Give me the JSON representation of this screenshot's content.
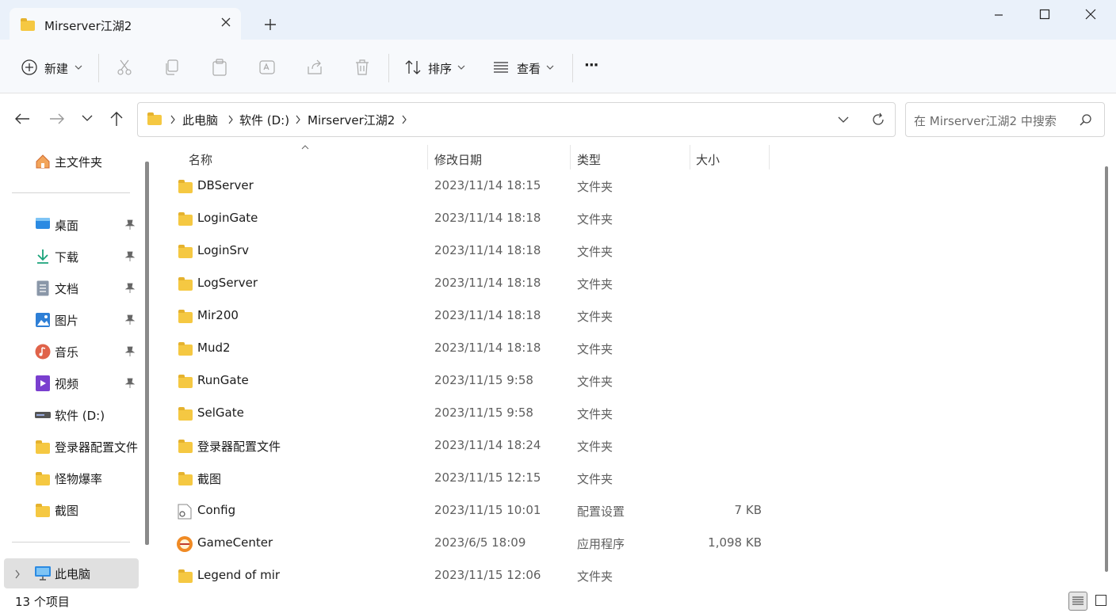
{
  "window": {
    "tab_title": "Mirserver江湖2",
    "minimize_icon": "minimize-icon",
    "maximize_icon": "maximize-icon",
    "close_icon": "close-icon"
  },
  "toolbar": {
    "new_label": "新建",
    "sort_label": "排序",
    "view_label": "查看",
    "more_label": "···"
  },
  "nav": {
    "breadcrumb": [
      "此电脑",
      "软件 (D:)",
      "Mirserver江湖2"
    ],
    "search_placeholder": "在 Mirserver江湖2 中搜索"
  },
  "sidebar": {
    "home": "主文件夹",
    "quick": [
      {
        "label": "桌面",
        "icon": "desktop-icon",
        "color": "#2b8ae2"
      },
      {
        "label": "下载",
        "icon": "download-icon",
        "color": "#1aa37a"
      },
      {
        "label": "文档",
        "icon": "document-icon",
        "color": "#6e7a8a"
      },
      {
        "label": "图片",
        "icon": "pictures-icon",
        "color": "#2e7fd6"
      },
      {
        "label": "音乐",
        "icon": "music-icon",
        "color": "#e0634a"
      },
      {
        "label": "视频",
        "icon": "video-icon",
        "color": "#7a3fcf"
      }
    ],
    "drives": [
      {
        "label": "软件 (D:)",
        "icon": "drive-icon"
      },
      {
        "label": "登录器配置文件",
        "icon": "folder-icon"
      },
      {
        "label": "怪物爆率",
        "icon": "folder-icon"
      },
      {
        "label": "截图",
        "icon": "folder-icon"
      }
    ],
    "this_pc": "此电脑"
  },
  "columns": {
    "name": "名称",
    "date": "修改日期",
    "type": "类型",
    "size": "大小"
  },
  "files": [
    {
      "name": "DBServer",
      "date": "2023/11/14 18:15",
      "type": "文件夹",
      "size": "",
      "icon": "folder-icon"
    },
    {
      "name": "LoginGate",
      "date": "2023/11/14 18:18",
      "type": "文件夹",
      "size": "",
      "icon": "folder-icon"
    },
    {
      "name": "LoginSrv",
      "date": "2023/11/14 18:18",
      "type": "文件夹",
      "size": "",
      "icon": "folder-icon"
    },
    {
      "name": "LogServer",
      "date": "2023/11/14 18:18",
      "type": "文件夹",
      "size": "",
      "icon": "folder-icon"
    },
    {
      "name": "Mir200",
      "date": "2023/11/14 18:18",
      "type": "文件夹",
      "size": "",
      "icon": "folder-icon"
    },
    {
      "name": "Mud2",
      "date": "2023/11/14 18:18",
      "type": "文件夹",
      "size": "",
      "icon": "folder-icon"
    },
    {
      "name": "RunGate",
      "date": "2023/11/15 9:58",
      "type": "文件夹",
      "size": "",
      "icon": "folder-icon"
    },
    {
      "name": "SelGate",
      "date": "2023/11/15 9:58",
      "type": "文件夹",
      "size": "",
      "icon": "folder-icon"
    },
    {
      "name": "登录器配置文件",
      "date": "2023/11/14 18:24",
      "type": "文件夹",
      "size": "",
      "icon": "folder-icon"
    },
    {
      "name": "截图",
      "date": "2023/11/15 12:15",
      "type": "文件夹",
      "size": "",
      "icon": "folder-icon"
    },
    {
      "name": "Config",
      "date": "2023/11/15 10:01",
      "type": "配置设置",
      "size": "7 KB",
      "icon": "config-file-icon"
    },
    {
      "name": "GameCenter",
      "date": "2023/6/5 18:09",
      "type": "应用程序",
      "size": "1,098 KB",
      "icon": "app-icon"
    },
    {
      "name": "Legend of mir",
      "date": "2023/11/15 12:06",
      "type": "文件夹",
      "size": "",
      "icon": "folder-icon"
    }
  ],
  "status": {
    "count": "13 个项目"
  }
}
